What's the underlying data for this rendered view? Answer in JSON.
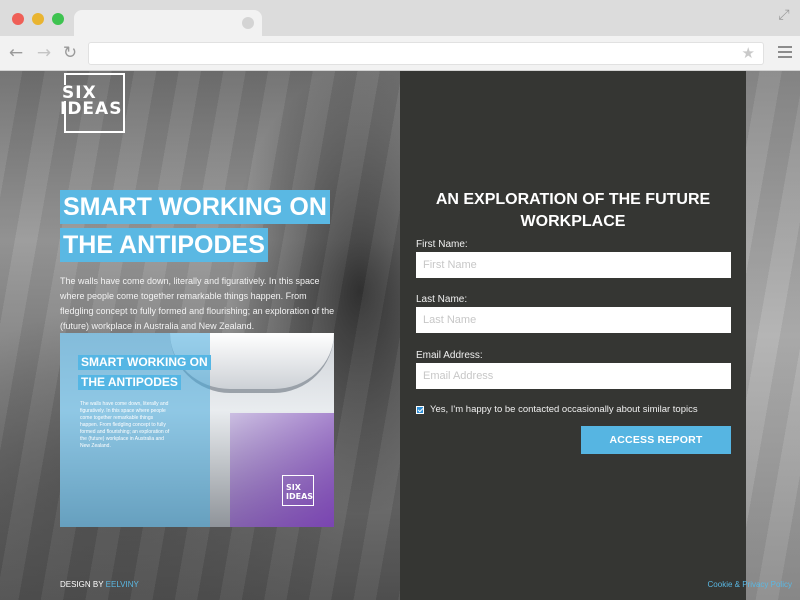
{
  "browser": {
    "star_icon": "★",
    "back_icon": "←",
    "forward_icon": "→",
    "reload_icon": "↻",
    "expand_icon": "⤢"
  },
  "hero": {
    "logo_line1": "SIX",
    "logo_line2": "IDEAS",
    "headline_line1": "SMART WORKING ON",
    "headline_line2": "THE ANTIPODES",
    "intro": "The walls have come down, literally and figuratively. In this space where people come together remarkable things happen. From fledgling concept to fully formed and flourishing; an exploration of the (future) workplace in Australia and New Zealand."
  },
  "promo": {
    "title_line1": "SMART WORKING ON",
    "title_line2": "THE ANTIPODES",
    "text": "The walls have come down, literally and figuratively. In this space where people come together remarkable things happen. From fledgling concept to fully formed and flourishing; an exploration of the (future) workplace in Australia and New Zealand.",
    "logo_line1": "SIX",
    "logo_line2": "IDEAS"
  },
  "footer": {
    "design_by": "DESIGN BY",
    "designer": "EELVINY",
    "cookie": "Cookie & Privacy Policy"
  },
  "form": {
    "title_line1": "AN EXPLORATION OF THE FUTURE",
    "title_line2": "WORKPLACE",
    "first_name_label": "First Name:",
    "first_name_placeholder": "First Name",
    "first_name_value": "",
    "last_name_label": "Last Name:",
    "last_name_placeholder": "Last Name",
    "last_name_value": "",
    "email_label": "Email Address:",
    "email_placeholder": "Email Address",
    "email_value": "",
    "consent_text": "Yes, I'm happy to be contacted occasionally about similar topics",
    "consent_checked": true,
    "submit_label": "ACCESS REPORT"
  },
  "colors": {
    "accent": "#5ab8e3",
    "panel": "#353633"
  }
}
